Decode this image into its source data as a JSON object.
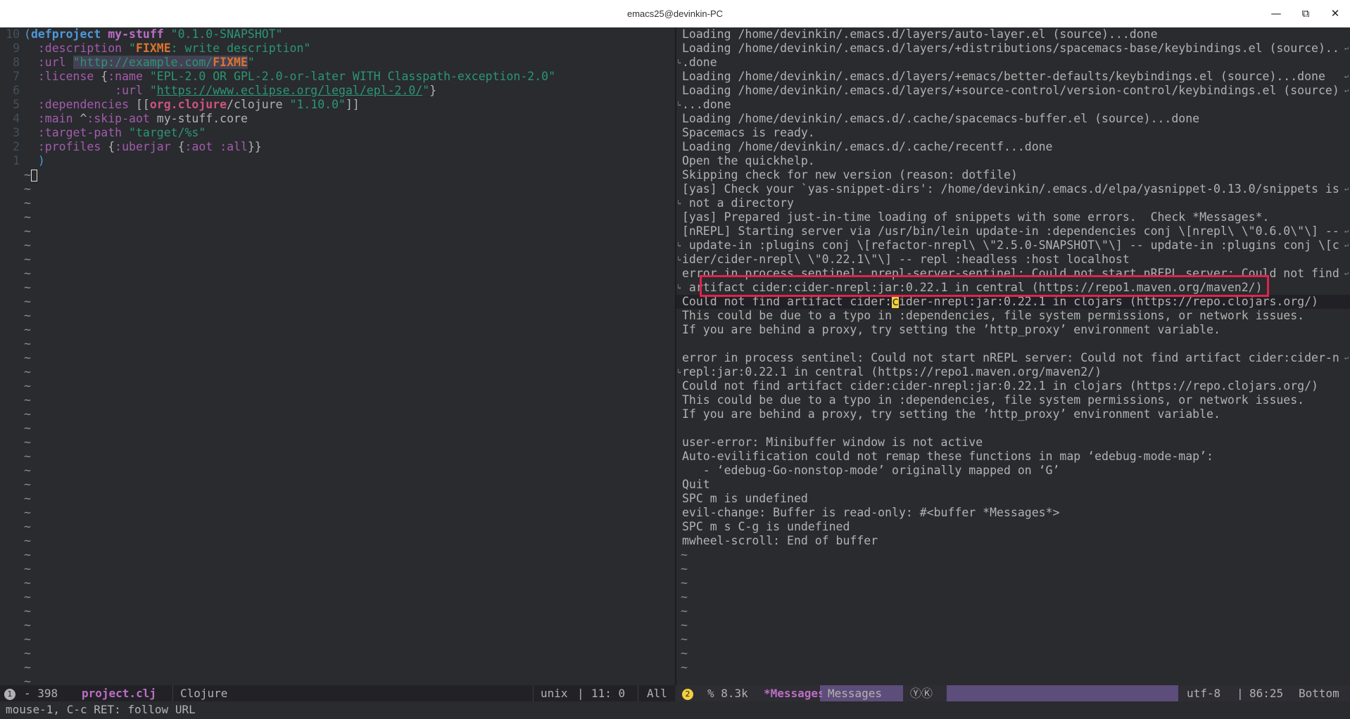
{
  "window": {
    "title": "emacs25@devinkin-PC",
    "minimize_icon": "minimize-icon",
    "maximize_icon": "maximize-icon",
    "close_icon": "close-icon"
  },
  "left_pane": {
    "lines": [
      {
        "num": "10",
        "segments": [
          {
            "c": "paren",
            "t": "("
          },
          {
            "c": "kw",
            "t": "defproject"
          },
          {
            "c": "txt",
            "t": " "
          },
          {
            "c": "fname",
            "t": "my-stuff"
          },
          {
            "c": "txt",
            "t": " "
          },
          {
            "c": "str",
            "t": "\"0.1.0-SNAPSHOT\""
          }
        ]
      },
      {
        "num": "9",
        "segments": [
          {
            "c": "txt",
            "t": "  "
          },
          {
            "c": "kwd",
            "t": ":description"
          },
          {
            "c": "txt",
            "t": " "
          },
          {
            "c": "str",
            "t": "\""
          },
          {
            "c": "fixme",
            "t": "FIXME"
          },
          {
            "c": "str",
            "t": ": write description\""
          }
        ]
      },
      {
        "num": "8",
        "segments": [
          {
            "c": "txt",
            "t": "  "
          },
          {
            "c": "kwd",
            "t": ":url"
          },
          {
            "c": "txt",
            "t": " "
          },
          {
            "c": "str urlhl",
            "t": "\"http://example.com/"
          },
          {
            "c": "fixme urlhl",
            "t": "FIXME"
          },
          {
            "c": "str",
            "t": "\""
          }
        ]
      },
      {
        "num": "7",
        "segments": [
          {
            "c": "txt",
            "t": "  "
          },
          {
            "c": "kwd",
            "t": ":license"
          },
          {
            "c": "txt",
            "t": " {"
          },
          {
            "c": "kwd",
            "t": ":name"
          },
          {
            "c": "txt",
            "t": " "
          },
          {
            "c": "str",
            "t": "\"EPL-2.0 OR GPL-2.0-or-later WITH Classpath-exception-2.0\""
          }
        ]
      },
      {
        "num": "6",
        "segments": [
          {
            "c": "txt",
            "t": "             "
          },
          {
            "c": "kwd",
            "t": ":url"
          },
          {
            "c": "txt",
            "t": " "
          },
          {
            "c": "str",
            "t": "\""
          },
          {
            "c": "url",
            "t": "https://www.eclipse.org/legal/epl-2.0/"
          },
          {
            "c": "str",
            "t": "\""
          },
          {
            "c": "txt",
            "t": "}"
          }
        ]
      },
      {
        "num": "5",
        "segments": [
          {
            "c": "txt",
            "t": "  "
          },
          {
            "c": "kwd",
            "t": ":dependencies"
          },
          {
            "c": "txt",
            "t": " [["
          },
          {
            "c": "ns",
            "t": "org.clojure"
          },
          {
            "c": "txt",
            "t": "/clojure "
          },
          {
            "c": "str",
            "t": "\"1.10.0\""
          },
          {
            "c": "txt",
            "t": "]]"
          }
        ]
      },
      {
        "num": "4",
        "segments": [
          {
            "c": "txt",
            "t": "  "
          },
          {
            "c": "kwd",
            "t": ":main"
          },
          {
            "c": "txt",
            "t": " ^"
          },
          {
            "c": "kwd",
            "t": ":skip-aot"
          },
          {
            "c": "txt",
            "t": " my-stuff.core"
          }
        ]
      },
      {
        "num": "3",
        "segments": [
          {
            "c": "txt",
            "t": "  "
          },
          {
            "c": "kwd",
            "t": ":target-path"
          },
          {
            "c": "txt",
            "t": " "
          },
          {
            "c": "str",
            "t": "\"target/%s\""
          }
        ]
      },
      {
        "num": "2",
        "segments": [
          {
            "c": "txt",
            "t": "  "
          },
          {
            "c": "kwd",
            "t": ":profiles"
          },
          {
            "c": "txt",
            "t": " {"
          },
          {
            "c": "kwd",
            "t": ":uberjar"
          },
          {
            "c": "txt",
            "t": " {"
          },
          {
            "c": "kwd",
            "t": ":aot"
          },
          {
            "c": "txt",
            "t": " "
          },
          {
            "c": "kwd",
            "t": ":all"
          },
          {
            "c": "txt",
            "t": "}}"
          }
        ]
      },
      {
        "num": "1",
        "segments": [
          {
            "c": "txt",
            "t": "  "
          },
          {
            "c": "paren",
            "t": ")"
          }
        ]
      }
    ],
    "tilde": "~",
    "tilde_lines": 37
  },
  "right_pane": {
    "lines": [
      {
        "t": "Loading /home/devinkin/.emacs.d/layers/auto-layer.el (source)...done"
      },
      {
        "t": "Loading /home/devinkin/.emacs.d/layers/+distributions/spacemacs-base/keybindings.el (source)..",
        "wrap": true
      },
      {
        "t": ".done",
        "cont": true
      },
      {
        "t": "Loading /home/devinkin/.emacs.d/layers/+emacs/better-defaults/keybindings.el (source)...done",
        "wrap": true
      },
      {
        "t": "Loading /home/devinkin/.emacs.d/layers/+source-control/version-control/keybindings.el (source)",
        "wrap": true
      },
      {
        "t": "...done",
        "cont": true
      },
      {
        "t": "Loading /home/devinkin/.emacs.d/.cache/spacemacs-buffer.el (source)...done"
      },
      {
        "t": "Spacemacs is ready."
      },
      {
        "t": "Loading /home/devinkin/.emacs.d/.cache/recentf...done"
      },
      {
        "t": "Open the quickhelp."
      },
      {
        "t": "Skipping check for new version (reason: dotfile)"
      },
      {
        "t": "[yas] Check your `yas-snippet-dirs': /home/devinkin/.emacs.d/elpa/yasnippet-0.13.0/snippets is",
        "wrap": true
      },
      {
        "t": " not a directory",
        "cont": true
      },
      {
        "t": "[yas] Prepared just-in-time loading of snippets with some errors.  Check *Messages*."
      },
      {
        "t": "[nREPL] Starting server via /usr/bin/lein update-in :dependencies conj \\[nrepl\\ \\\"0.6.0\\\"\\] --",
        "wrap": true
      },
      {
        "t": " update-in :plugins conj \\[refactor-nrepl\\ \\\"2.5.0-SNAPSHOT\\\"\\] -- update-in :plugins conj \\[c",
        "cont": true,
        "wrap": true
      },
      {
        "t": "ider/cider-nrepl\\ \\\"0.22.1\\\"\\] -- repl :headless :host localhost",
        "cont": true
      },
      {
        "t": "error in process sentinel: nrepl-server-sentinel: Could not start nREPL server: Could not find",
        "wrap": true
      },
      {
        "t": " artifact cider:cider-nrepl:jar:0.22.1 in central (https://repo1.maven.org/maven2/)",
        "cont": true
      },
      {
        "t": "Could not find artifact cider:cider-nrepl:jar:0.22.1 in clojars (https://repo.clojars.org/)",
        "current": true
      },
      {
        "t": "This could be due to a typo in :dependencies, file system permissions, or network issues."
      },
      {
        "t": "If you are behind a proxy, try setting the ’http_proxy’ environment variable."
      },
      {
        "t": ""
      },
      {
        "t": "error in process sentinel: Could not start nREPL server: Could not find artifact cider:cider-n",
        "wrap": true
      },
      {
        "t": "repl:jar:0.22.1 in central (https://repo1.maven.org/maven2/)",
        "cont": true
      },
      {
        "t": "Could not find artifact cider:cider-nrepl:jar:0.22.1 in clojars (https://repo.clojars.org/)"
      },
      {
        "t": "This could be due to a typo in :dependencies, file system permissions, or network issues."
      },
      {
        "t": "If you are behind a proxy, try setting the ’http_proxy’ environment variable."
      },
      {
        "t": ""
      },
      {
        "t": "user-error: Minibuffer window is not active"
      },
      {
        "t": "Auto-evilification could not remap these functions in map ‘edebug-mode-map’:"
      },
      {
        "t": "   - ‘edebug-Go-nonstop-mode’ originally mapped on ‘G’"
      },
      {
        "t": "Quit"
      },
      {
        "t": "SPC m is undefined"
      },
      {
        "t": "evil-change: Buffer is read-only: #<buffer *Messages*>"
      },
      {
        "t": "SPC m s C-g is undefined"
      },
      {
        "t": "mwheel-scroll: End of buffer"
      }
    ],
    "tilde": "~",
    "tilde_lines": 9,
    "fringe_wrap": "↵",
    "fringe_cont": "↳"
  },
  "modeline_left": {
    "window_number": "1",
    "status": "- 398",
    "buffer_name": "project.clj",
    "major_mode": "Clojure",
    "eol": "unix",
    "position": "11: 0",
    "scroll": "All",
    "separator": "|",
    "bg": "#222226"
  },
  "modeline_right": {
    "window_number": "2",
    "size": "% 8.3k",
    "buffer_name": "*Messages*",
    "major_mode": "Messages",
    "minor_modes": "ⓎⓀ",
    "encoding": "utf-8",
    "position": "86:25",
    "scroll": "Bottom",
    "separator": "|",
    "bg": "#5d4d7a"
  },
  "minibuffer": {
    "text": "mouse-1, C-c RET: follow URL"
  },
  "colors": {
    "background": "#292b2e",
    "keyword": "#4f97d7",
    "string": "#2d9574",
    "highlight_box": "#e0234e",
    "cursor_yellow": "#f2d13c",
    "active_modeline_number": "#f2d13c"
  }
}
